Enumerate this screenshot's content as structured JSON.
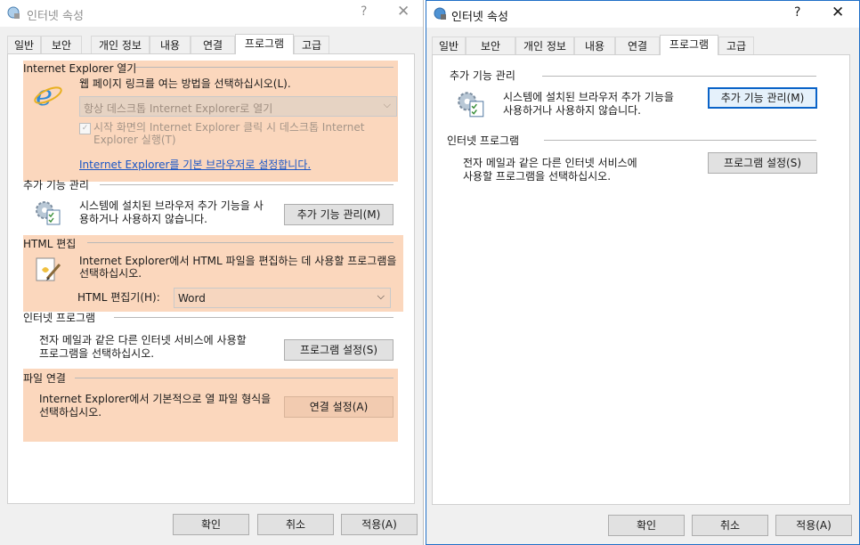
{
  "left": {
    "title": "인터넷 속성",
    "help": "?",
    "close": "✕",
    "tabs": [
      "일반",
      "보안",
      "개인 정보",
      "내용",
      "연결",
      "프로그램",
      "고급"
    ],
    "ie": {
      "heading": "Internet Explorer 열기",
      "desc": "웹 페이지 링크를 여는 방법을 선택하십시오(L).",
      "combo_value": "항상 데스크톱 Internet Explorer로 열기",
      "checkbox_label_1": "시작 화면의 Internet Explorer 클릭 시 데스크톱 Internet",
      "checkbox_label_2": "Explorer 실행(T)",
      "link": "Internet Explorer를 기본 브라우저로 설정합니다."
    },
    "addons": {
      "heading": "추가 기능 관리",
      "desc_1": "시스템에 설치된 브라우저 추가 기능을 사",
      "desc_2": "용하거나 사용하지 않습니다.",
      "button": "추가 기능 관리(M)"
    },
    "html": {
      "heading": "HTML 편집",
      "desc_1": "Internet Explorer에서 HTML 파일을 편집하는 데 사용할 프로그램을",
      "desc_2": "선택하십시오.",
      "editor_label": "HTML 편집기(H):",
      "editor_value": "Word"
    },
    "programs": {
      "heading": "인터넷 프로그램",
      "desc_1": "전자 메일과 같은 다른 인터넷 서비스에 사용할",
      "desc_2": "프로그램을 선택하십시오.",
      "button": "프로그램 설정(S)"
    },
    "assoc": {
      "heading": "파일 연결",
      "desc_1": "Internet Explorer에서 기본적으로 열 파일 형식을",
      "desc_2": "선택하십시오.",
      "button": "연결 설정(A)"
    },
    "footer": {
      "ok": "확인",
      "cancel": "취소",
      "apply": "적용(A)"
    }
  },
  "right": {
    "title": "인터넷 속성",
    "help": "?",
    "close": "✕",
    "tabs": [
      "일반",
      "보안",
      "개인 정보",
      "내용",
      "연결",
      "프로그램",
      "고급"
    ],
    "addons": {
      "heading": "추가 기능 관리",
      "desc_1": "시스템에 설치된 브라우저 추가 기능을",
      "desc_2": "사용하거나 사용하지 않습니다.",
      "button": "추가 기능 관리(M)"
    },
    "programs": {
      "heading": "인터넷 프로그램",
      "desc_1": "전자 메일과 같은 다른 인터넷 서비스에",
      "desc_2": "사용할 프로그램을 선택하십시오.",
      "button": "프로그램 설정(S)"
    },
    "footer": {
      "ok": "확인",
      "cancel": "취소",
      "apply": "적용(A)"
    }
  },
  "colors": {
    "highlight": "#fbd7bd",
    "focus_border": "#0a63c8",
    "link": "#1a56c6"
  },
  "icons": [
    "globe-settings-icon",
    "internet-explorer-icon",
    "addons-gear-icon",
    "html-editor-icon",
    "checkbox-icon",
    "chevron-down-icon"
  ]
}
